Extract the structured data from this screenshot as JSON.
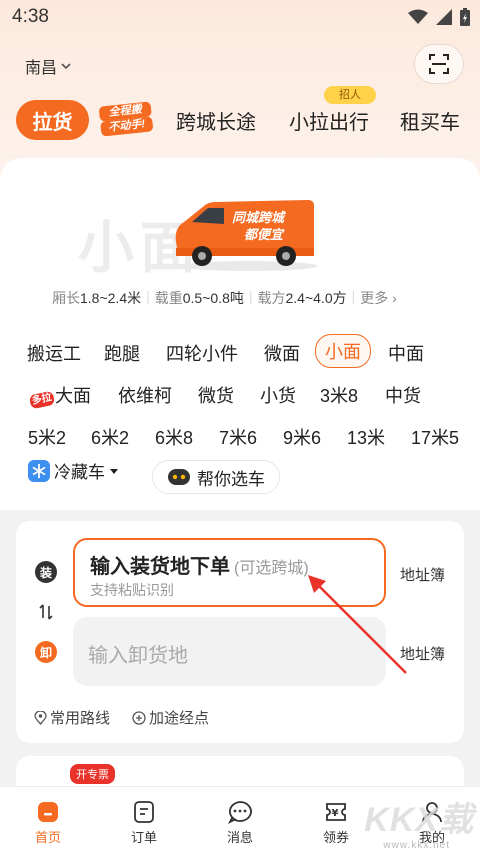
{
  "status": {
    "time": "4:38"
  },
  "location": {
    "city": "南昌"
  },
  "tabs": {
    "active": "拉货",
    "badge_line1": "全程搬",
    "badge_line2": "不动手!",
    "items": [
      "跨城长途",
      "小拉出行",
      "租买车"
    ],
    "hot_label": "招人"
  },
  "vehicle": {
    "big_name": "小面",
    "van_slogan_1": "同城跨城",
    "van_slogan_2": "都便宜",
    "specs": [
      {
        "label": "厢长",
        "value": "1.8~2.4米"
      },
      {
        "label": "载重",
        "value": "0.5~0.8吨"
      },
      {
        "label": "载方",
        "value": "2.4~4.0方"
      }
    ],
    "more": "更多"
  },
  "vehicle_types": {
    "row1": [
      "搬运工",
      "跑腿",
      "四轮小件",
      "微面",
      "小面",
      "中面"
    ],
    "row2_tag": "多拉",
    "row2": [
      "大面",
      "依维柯",
      "微货",
      "小货",
      "3米8",
      "中货"
    ],
    "row3": [
      "5米2",
      "6米2",
      "6米8",
      "7米6",
      "9米6",
      "13米",
      "17米5"
    ],
    "selected": "小面"
  },
  "extras": {
    "cold_truck": "冷藏车",
    "help_pick": "帮你选车"
  },
  "order": {
    "pickup_pin": "装",
    "dropoff_pin": "卸",
    "pickup_main": "输入装货地下单",
    "pickup_optional": "(可选跨城)",
    "pickup_sub": "支持粘贴识别",
    "dropoff_placeholder": "输入卸货地",
    "address_book": "地址簿",
    "common_routes": "常用路线",
    "add_stop": "加途经点"
  },
  "service_badge": "开专票",
  "tabbar": [
    {
      "label": "首页",
      "icon": "home-icon"
    },
    {
      "label": "订单",
      "icon": "order-icon"
    },
    {
      "label": "消息",
      "icon": "message-icon"
    },
    {
      "label": "领券",
      "icon": "coupon-icon"
    },
    {
      "label": "我的",
      "icon": "profile-icon"
    }
  ],
  "watermark": {
    "text": "KKX载",
    "url": "www.kkx.net"
  },
  "colors": {
    "accent": "#f46a20",
    "pin_pickup": "#333333",
    "pin_dropoff": "#f46a20",
    "arrow": "#e8322a"
  }
}
